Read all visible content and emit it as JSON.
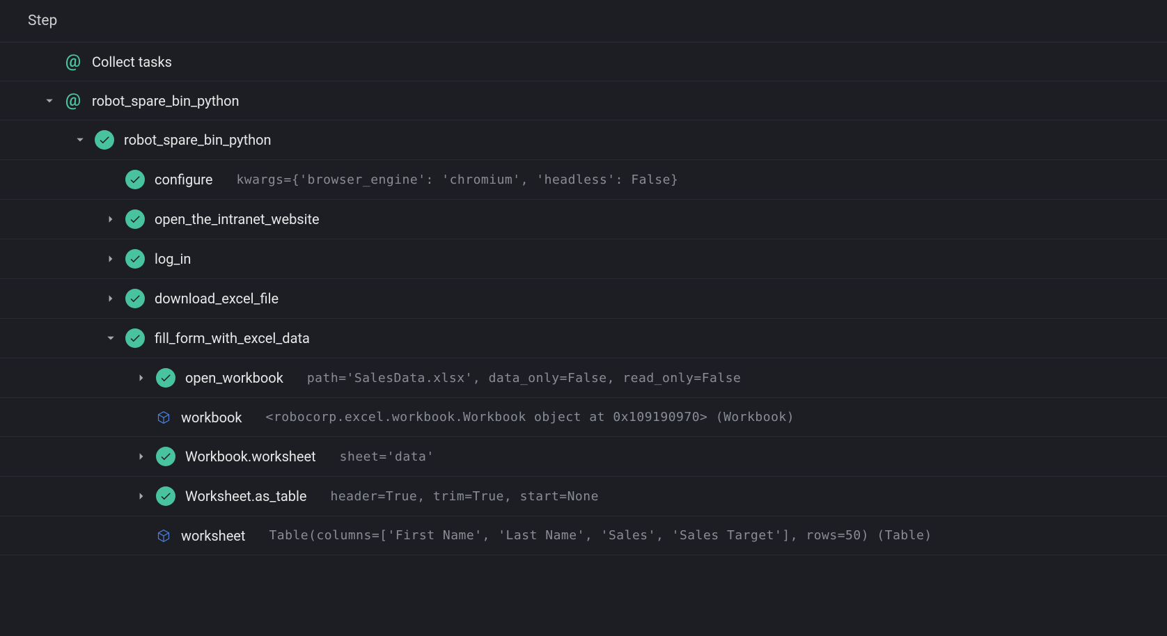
{
  "header": {
    "title": "Step"
  },
  "rows": [
    {
      "indent": 1,
      "triangle": null,
      "icon": "at",
      "name": "Collect tasks",
      "args": null
    },
    {
      "indent": 1,
      "triangle": "down",
      "icon": "at",
      "name": "robot_spare_bin_python",
      "args": null
    },
    {
      "indent": 2,
      "triangle": "down",
      "icon": "check",
      "name": "robot_spare_bin_python",
      "args": null
    },
    {
      "indent": 3,
      "triangle": null,
      "icon": "check",
      "name": "configure",
      "args": "kwargs={'browser_engine': 'chromium', 'headless': False}"
    },
    {
      "indent": 3,
      "triangle": "right",
      "icon": "check",
      "name": "open_the_intranet_website",
      "args": null
    },
    {
      "indent": 3,
      "triangle": "right",
      "icon": "check",
      "name": "log_in",
      "args": null
    },
    {
      "indent": 3,
      "triangle": "right",
      "icon": "check",
      "name": "download_excel_file",
      "args": null
    },
    {
      "indent": 3,
      "triangle": "down",
      "icon": "check",
      "name": "fill_form_with_excel_data",
      "args": null
    },
    {
      "indent": 4,
      "triangle": "right",
      "icon": "check",
      "name": "open_workbook",
      "args": "path='SalesData.xlsx', data_only=False, read_only=False"
    },
    {
      "indent": 4,
      "triangle": null,
      "icon": "cube",
      "name": "workbook",
      "args": "<robocorp.excel.workbook.Workbook object at 0x109190970> (Workbook)"
    },
    {
      "indent": 4,
      "triangle": "right",
      "icon": "check",
      "name": "Workbook.worksheet",
      "args": "sheet='data'"
    },
    {
      "indent": 4,
      "triangle": "right",
      "icon": "check",
      "name": "Worksheet.as_table",
      "args": "header=True, trim=True, start=None"
    },
    {
      "indent": 4,
      "triangle": null,
      "icon": "cube",
      "name": "worksheet",
      "args": "Table(columns=['First Name', 'Last Name', 'Sales', 'Sales Target'], rows=50) (Table)"
    }
  ]
}
